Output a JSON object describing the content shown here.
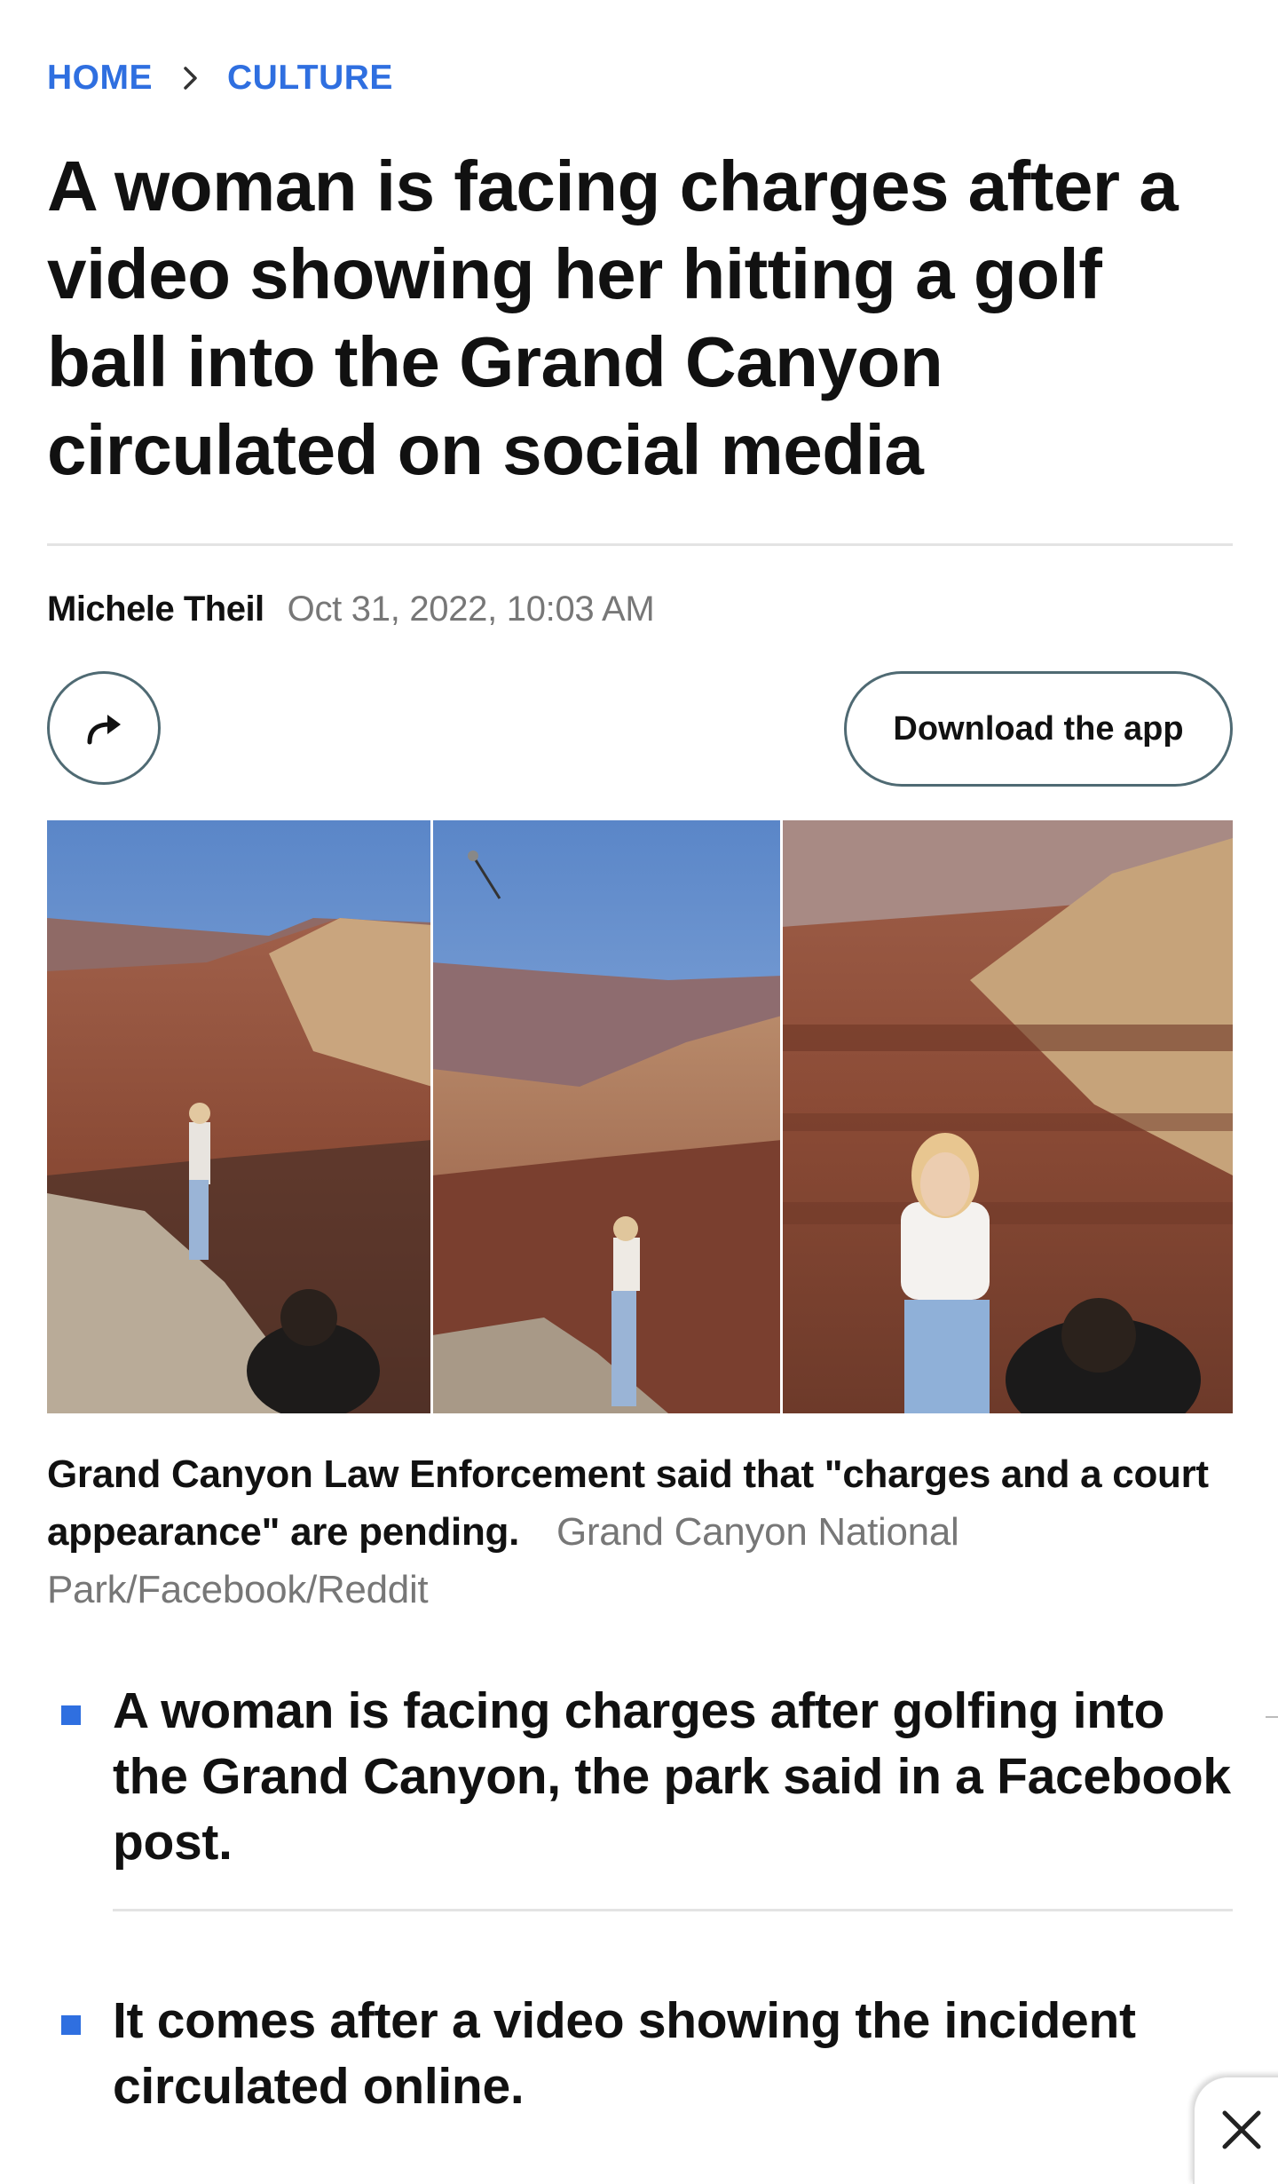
{
  "breadcrumb": {
    "home": "HOME",
    "section": "CULTURE",
    "separator_icon": "chevron-right-icon"
  },
  "article": {
    "headline": "A woman is facing charges after a video showing her hitting a golf ball into the Grand Canyon circulated on social media",
    "author": "Michele Theil",
    "date": "Oct 31, 2022, 10:03 AM"
  },
  "actions": {
    "share_icon": "share-arrow-icon",
    "download_label": "Download the app"
  },
  "image": {
    "caption": "Grand Canyon Law Enforcement said that \"charges and a court appearance\" are pending.",
    "credit": "Grand Canyon National Park/Facebook/Reddit"
  },
  "bullets": [
    "A woman is facing charges after golfing into the Grand Canyon, the park said in a Facebook post.",
    "It comes after a video showing the incident circulated online."
  ],
  "overlay": {
    "close_icon": "close-icon"
  },
  "colors": {
    "accent": "#2f6fe0",
    "text": "#111111",
    "muted": "#777777",
    "border": "#4f6a73"
  }
}
